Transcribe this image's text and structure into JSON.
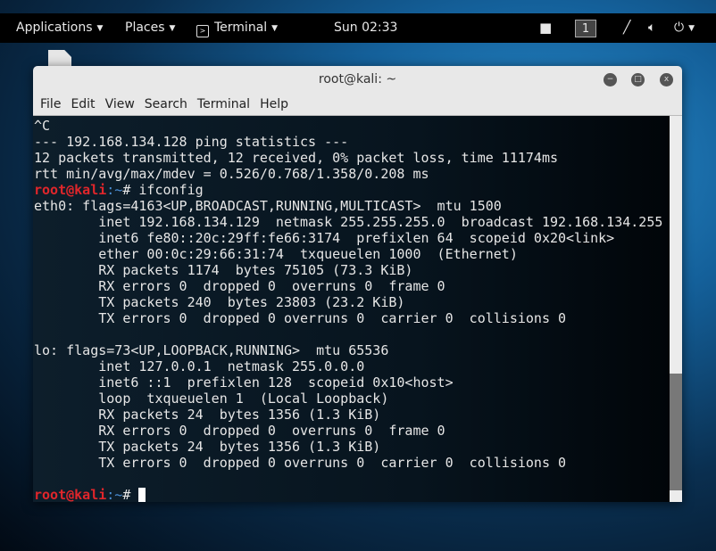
{
  "topbar": {
    "applications": "Applications",
    "places": "Places",
    "terminal": "Terminal",
    "clock": "Sun 02:33",
    "workspace": "1"
  },
  "window": {
    "title": "root@kali: ~",
    "menu": [
      "File",
      "Edit",
      "View",
      "Search",
      "Terminal",
      "Help"
    ]
  },
  "terminal": {
    "prompt_user": "root@kali",
    "prompt_path": ":~",
    "prompt_sym": "# ",
    "command": "ifconfig",
    "pre_lines": [
      "^C",
      "--- 192.168.134.128 ping statistics ---",
      "12 packets transmitted, 12 received, 0% packet loss, time 11174ms",
      "rtt min/avg/max/mdev = 0.526/0.768/1.358/0.208 ms"
    ],
    "output_lines": [
      "eth0: flags=4163<UP,BROADCAST,RUNNING,MULTICAST>  mtu 1500",
      "        inet 192.168.134.129  netmask 255.255.255.0  broadcast 192.168.134.255",
      "        inet6 fe80::20c:29ff:fe66:3174  prefixlen 64  scopeid 0x20<link>",
      "        ether 00:0c:29:66:31:74  txqueuelen 1000  (Ethernet)",
      "        RX packets 1174  bytes 75105 (73.3 KiB)",
      "        RX errors 0  dropped 0  overruns 0  frame 0",
      "        TX packets 240  bytes 23803 (23.2 KiB)",
      "        TX errors 0  dropped 0 overruns 0  carrier 0  collisions 0",
      "",
      "lo: flags=73<UP,LOOPBACK,RUNNING>  mtu 65536",
      "        inet 127.0.0.1  netmask 255.0.0.0",
      "        inet6 ::1  prefixlen 128  scopeid 0x10<host>",
      "        loop  txqueuelen 1  (Local Loopback)",
      "        RX packets 24  bytes 1356 (1.3 KiB)",
      "        RX errors 0  dropped 0  overruns 0  frame 0",
      "        TX packets 24  bytes 1356 (1.3 KiB)",
      "        TX errors 0  dropped 0 overruns 0  carrier 0  collisions 0",
      ""
    ]
  }
}
